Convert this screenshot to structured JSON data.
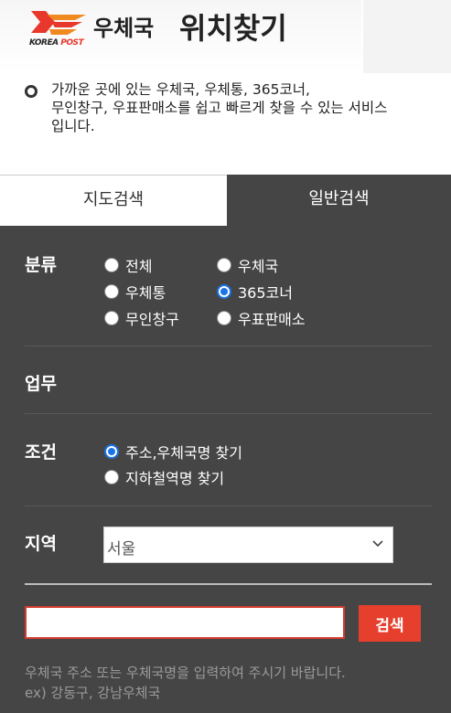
{
  "header": {
    "logo_text_korea": "KOREA",
    "logo_text_post": "POST",
    "title_small": "우체국",
    "title_large": "위치찾기"
  },
  "description": {
    "line1": "가까운 곳에 있는 우체국, 우체통, 365코너,",
    "line2": "무인창구, 우표판매소를 쉽고 빠르게 찾을 수 있는 서비스",
    "line3": "입니다."
  },
  "tabs": [
    {
      "label": "지도검색",
      "active": false
    },
    {
      "label": "일반검색",
      "active": true
    }
  ],
  "category": {
    "label": "분류",
    "options": [
      {
        "label": "전체",
        "checked": false
      },
      {
        "label": "우체국",
        "checked": false
      },
      {
        "label": "우체통",
        "checked": false
      },
      {
        "label": "365코너",
        "checked": true
      },
      {
        "label": "무인창구",
        "checked": false
      },
      {
        "label": "우표판매소",
        "checked": false
      }
    ]
  },
  "business": {
    "label": "업무"
  },
  "condition": {
    "label": "조건",
    "options": [
      {
        "label": "주소,우체국명 찾기",
        "checked": true
      },
      {
        "label": "지하철역명 찾기",
        "checked": false
      }
    ]
  },
  "region": {
    "label": "지역",
    "selected": "서울"
  },
  "search": {
    "value": "",
    "button_label": "검색",
    "help_line1": "우체국 주소 또는 우체국명을 입력하여 주시기 바랍니다.",
    "help_line2": "ex) 강동구, 강남우체국"
  },
  "colors": {
    "panel_bg": "#454545",
    "accent_red": "#e63f2e",
    "radio_blue": "#1a73e8"
  }
}
